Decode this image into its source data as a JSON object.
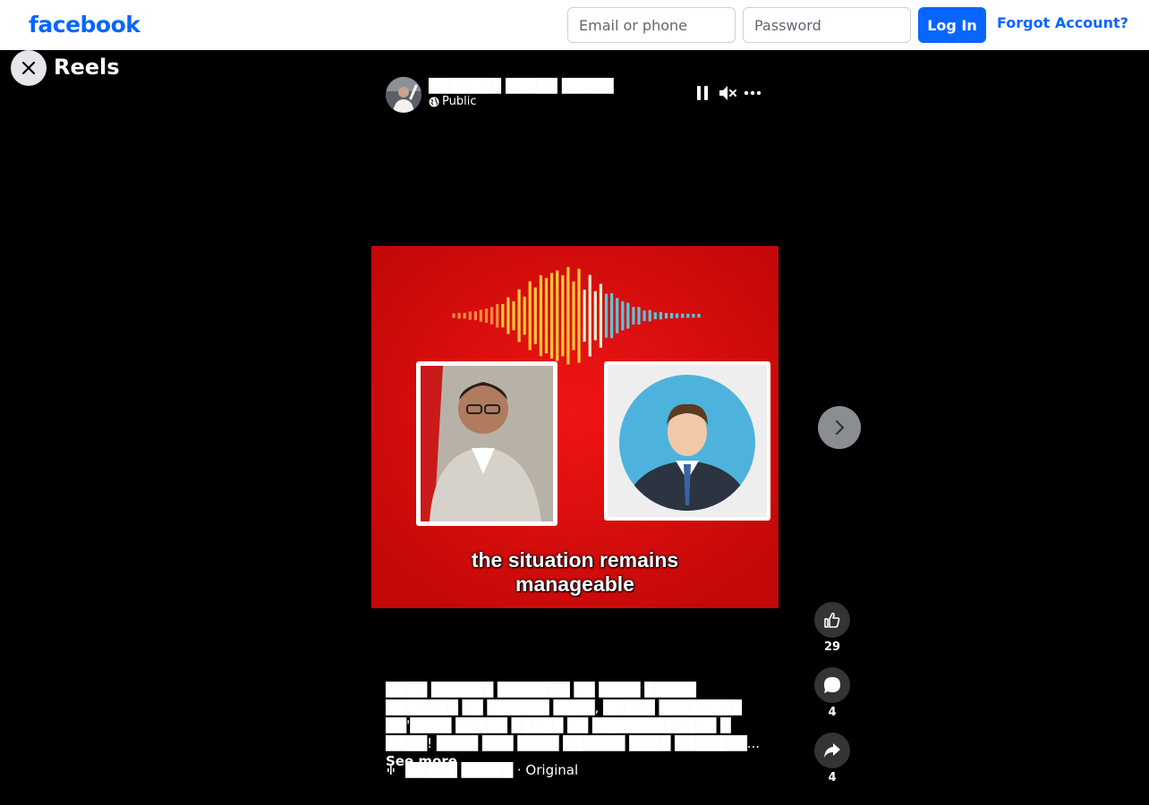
{
  "topbar": {
    "logo": "facebook",
    "email_placeholder": "Email or phone",
    "password_placeholder": "Password",
    "login_label": "Log In",
    "forgot_label": "Forgot Account?"
  },
  "reels": {
    "title": "Reels",
    "close_icon": "close-icon",
    "next_icon": "chevron-right-icon"
  },
  "post": {
    "author_name": "███████ █████ █████",
    "privacy": "Public",
    "privacy_icon": "globe-icon",
    "controls": [
      "pause-icon",
      "muted-icon",
      "more-icon"
    ]
  },
  "video": {
    "subtitle_line1": "the situation remains",
    "subtitle_line2": "manageable",
    "background_color": "#d40b0b"
  },
  "actions": {
    "likes": "29",
    "comments": "4",
    "shares": "4"
  },
  "caption": {
    "text": "████ ██████ ███████ ██ ████ █████ ███████ ██ ██████ ████, █████ ████████ ██'████ █████ █████ ██ ████████████ █ ████! ████ ███ ████ ██████ ████ ███████",
    "ellipsis": "...",
    "see_more": "See more"
  },
  "audio": {
    "icon": "audio-wave-icon",
    "track_name": "█████ █████",
    "suffix": " · Original"
  },
  "colors": {
    "brand_blue": "#0866ff",
    "background": "#000000",
    "action_button_bg": "#323436"
  }
}
